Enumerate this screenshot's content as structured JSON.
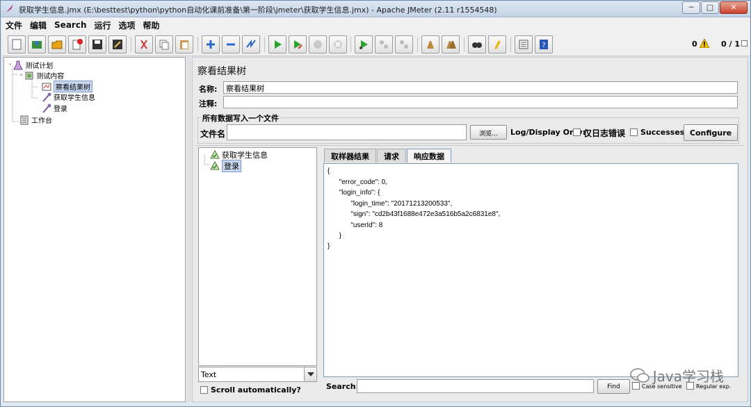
{
  "window": {
    "title": "获取学生信息.jmx (E:\\besttest\\python\\python自动化课前准备\\第一阶段\\jmeter\\获取学生信息.jmx) - Apache JMeter (2.11 r1554548)",
    "minimize": "─",
    "maximize": "□",
    "close": "✕"
  },
  "menu": [
    "文件",
    "编辑",
    "Search",
    "运行",
    "选项",
    "帮助"
  ],
  "toolbar": {
    "status_warnings": "0",
    "status_threads": "0 / 1"
  },
  "tree": {
    "items": [
      {
        "label": "测试计划",
        "icon": "flask-icon"
      },
      {
        "label": "测试内容",
        "icon": "thread-group-icon"
      },
      {
        "label": "察看结果树",
        "icon": "result-tree-icon",
        "selected": true
      },
      {
        "label": "获取学生信息",
        "icon": "sampler-icon"
      },
      {
        "label": "登录",
        "icon": "sampler-icon"
      },
      {
        "label": "工作台",
        "icon": "workbench-icon"
      }
    ]
  },
  "panel": {
    "title": "察看结果树",
    "name_label": "名称:",
    "name_value": "察看结果树",
    "comment_label": "注释:",
    "comment_value": "",
    "group_title": "所有数据写入一个文件",
    "filename_label": "文件名",
    "filename_value": "",
    "browse_button": "浏览...",
    "log_display_label": "Log/Display Only:",
    "errors_only_label": "仅日志错误",
    "successes_label": "Successes",
    "configure_button": "Configure"
  },
  "results": {
    "items": [
      {
        "label": "获取学生信息"
      },
      {
        "label": "登录",
        "selected": true
      }
    ],
    "render_type": "Text",
    "scroll_label": "Scroll automatically?"
  },
  "tabs": [
    {
      "label": "取样器结果",
      "active": false
    },
    {
      "label": "请求",
      "active": false
    },
    {
      "label": "响应数据",
      "active": true
    }
  ],
  "response_lines": [
    "{",
    "      \"error_code\": 0,",
    "      \"login_info\": {",
    "            \"login_time\": \"20171213200533\",",
    "            \"sign\": \"cd2b43f1688e472e3a516b5a2c6831e8\",",
    "            \"userId\": 8",
    "      }",
    "}"
  ],
  "search": {
    "label": "Search:",
    "value": "",
    "find_button": "Find",
    "case_sensitive_label": "Case sensitive",
    "regex_label": "Regular exp."
  },
  "watermark": "Java学习栈"
}
